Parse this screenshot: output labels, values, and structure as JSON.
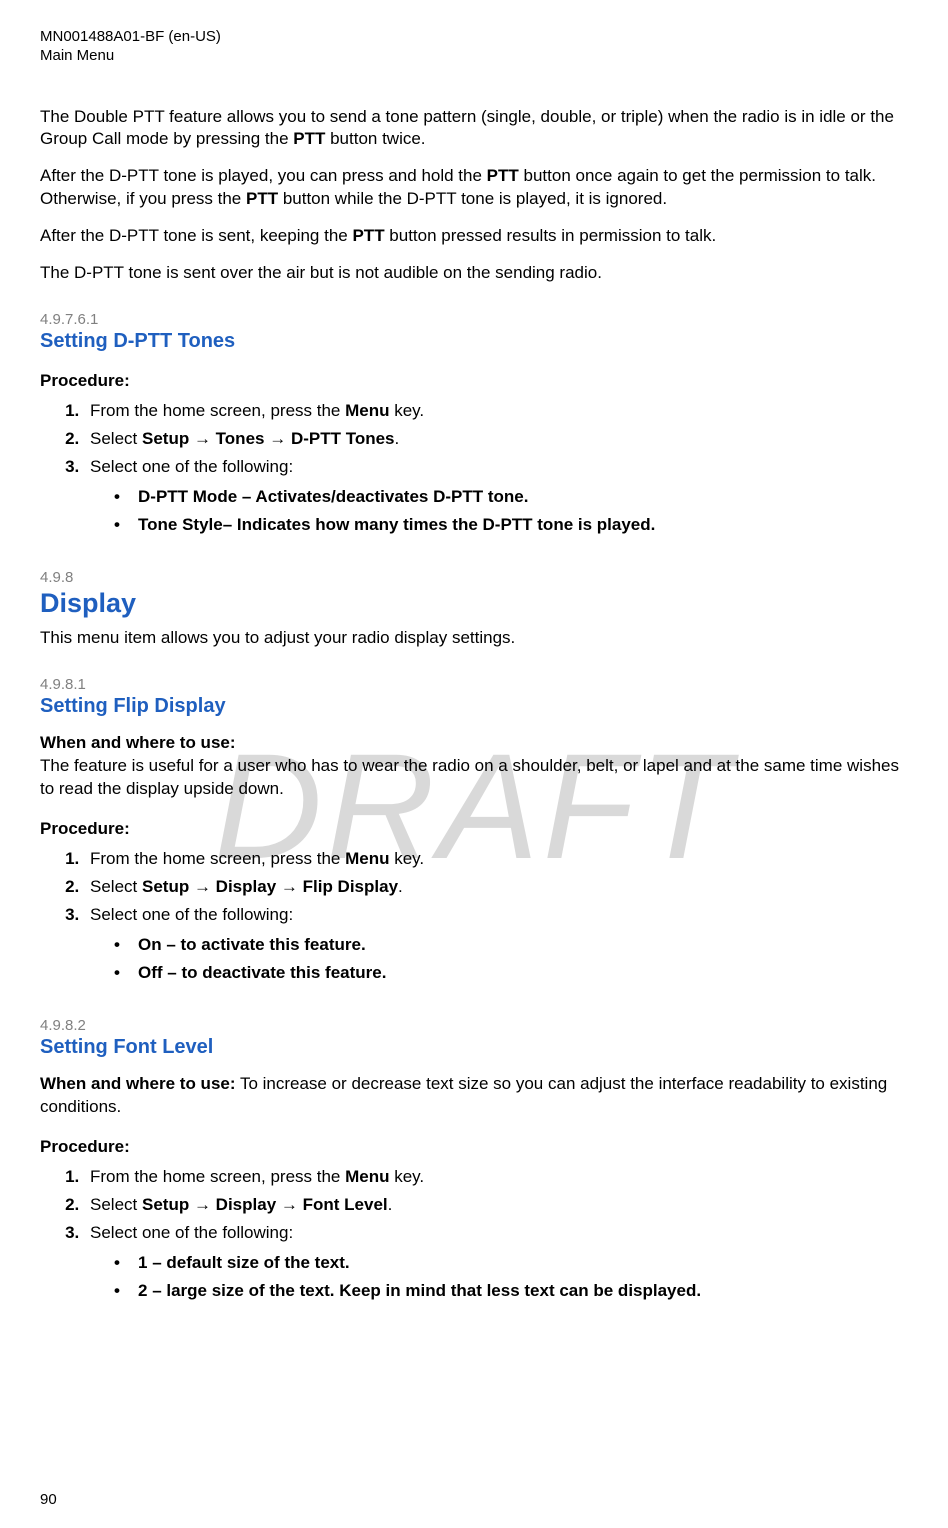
{
  "header": {
    "doc_id": "MN001488A01-BF (en-US)",
    "section": "Main Menu"
  },
  "watermark": "DRAFT",
  "page_number": "90",
  "intro": {
    "p1_a": "The Double PTT feature allows you to send a tone pattern (single, double, or triple) when the radio is in idle or the Group Call mode by pressing the ",
    "p1_b_bold": "PTT",
    "p1_c": " button twice.",
    "p2_a": "After the D-PTT tone is played, you can press and hold the ",
    "p2_b_bold": "PTT",
    "p2_c": " button once again to get the permission to talk. Otherwise, if you press the ",
    "p2_d_bold": "PTT",
    "p2_e": " button while the D-PTT tone is played, it is ignored.",
    "p3_a": "After the D-PTT tone is sent, keeping the ",
    "p3_b_bold": "PTT",
    "p3_c": " button pressed results in permission to talk.",
    "p4": "The D-PTT tone is sent over the air but is not audible on the sending radio."
  },
  "sec1": {
    "num": "4.9.7.6.1",
    "title": "Setting D-PTT Tones",
    "proc_label": "Procedure:",
    "step1_a": "From the home screen, press the ",
    "step1_b_bold": "Menu",
    "step1_c": " key.",
    "step2_a": "Select ",
    "step2_b_bold": "Setup",
    "step2_c": " → ",
    "step2_d_bold": "Tones",
    "step2_e": " → ",
    "step2_f_bold": "D-PTT Tones",
    "step2_g": ".",
    "step3": "Select one of the following:",
    "b1_bold": "D-PTT Mode",
    "b1_rest": " – Activates/deactivates D-PTT tone.",
    "b2_bold": "Tone Style",
    "b2_rest": "– Indicates how many times the D-PTT tone is played."
  },
  "sec2": {
    "num": "4.9.8",
    "title": "Display",
    "desc": "This menu item allows you to adjust your radio display settings."
  },
  "sec3": {
    "num": "4.9.8.1",
    "title": "Setting Flip Display",
    "when_label": "When and where to use:",
    "when_text": "The feature is useful for a user who has to wear the radio on a shoulder, belt, or lapel and at the same time wishes to read the display upside down.",
    "proc_label": "Procedure:",
    "step1_a": "From the home screen, press the ",
    "step1_b_bold": "Menu",
    "step1_c": " key.",
    "step2_a": "Select ",
    "step2_b_bold": "Setup",
    "step2_c": " → ",
    "step2_d_bold": "Display",
    "step2_e": " → ",
    "step2_f_bold": "Flip Display",
    "step2_g": ".",
    "step3": "Select one of the following:",
    "b1_bold": "On",
    "b1_rest": " – to activate this feature.",
    "b2_bold": "Off",
    "b2_rest": " – to deactivate this feature."
  },
  "sec4": {
    "num": "4.9.8.2",
    "title": "Setting Font Level",
    "when_label": "When and where to use:",
    "when_text": " To increase or decrease text size so you can adjust the interface readability to existing conditions.",
    "proc_label": "Procedure:",
    "step1_a": "From the home screen, press the ",
    "step1_b_bold": "Menu",
    "step1_c": " key.",
    "step2_a": "Select ",
    "step2_b_bold": "Setup",
    "step2_c": " → ",
    "step2_d_bold": "Display",
    "step2_e": " → ",
    "step2_f_bold": "Font Level",
    "step2_g": ".",
    "step3": "Select one of the following:",
    "b1_bold": "1",
    "b1_rest": " – default size of the text.",
    "b2_bold": "2",
    "b2_rest": " – large size of the text. Keep in mind that less text can be displayed."
  }
}
